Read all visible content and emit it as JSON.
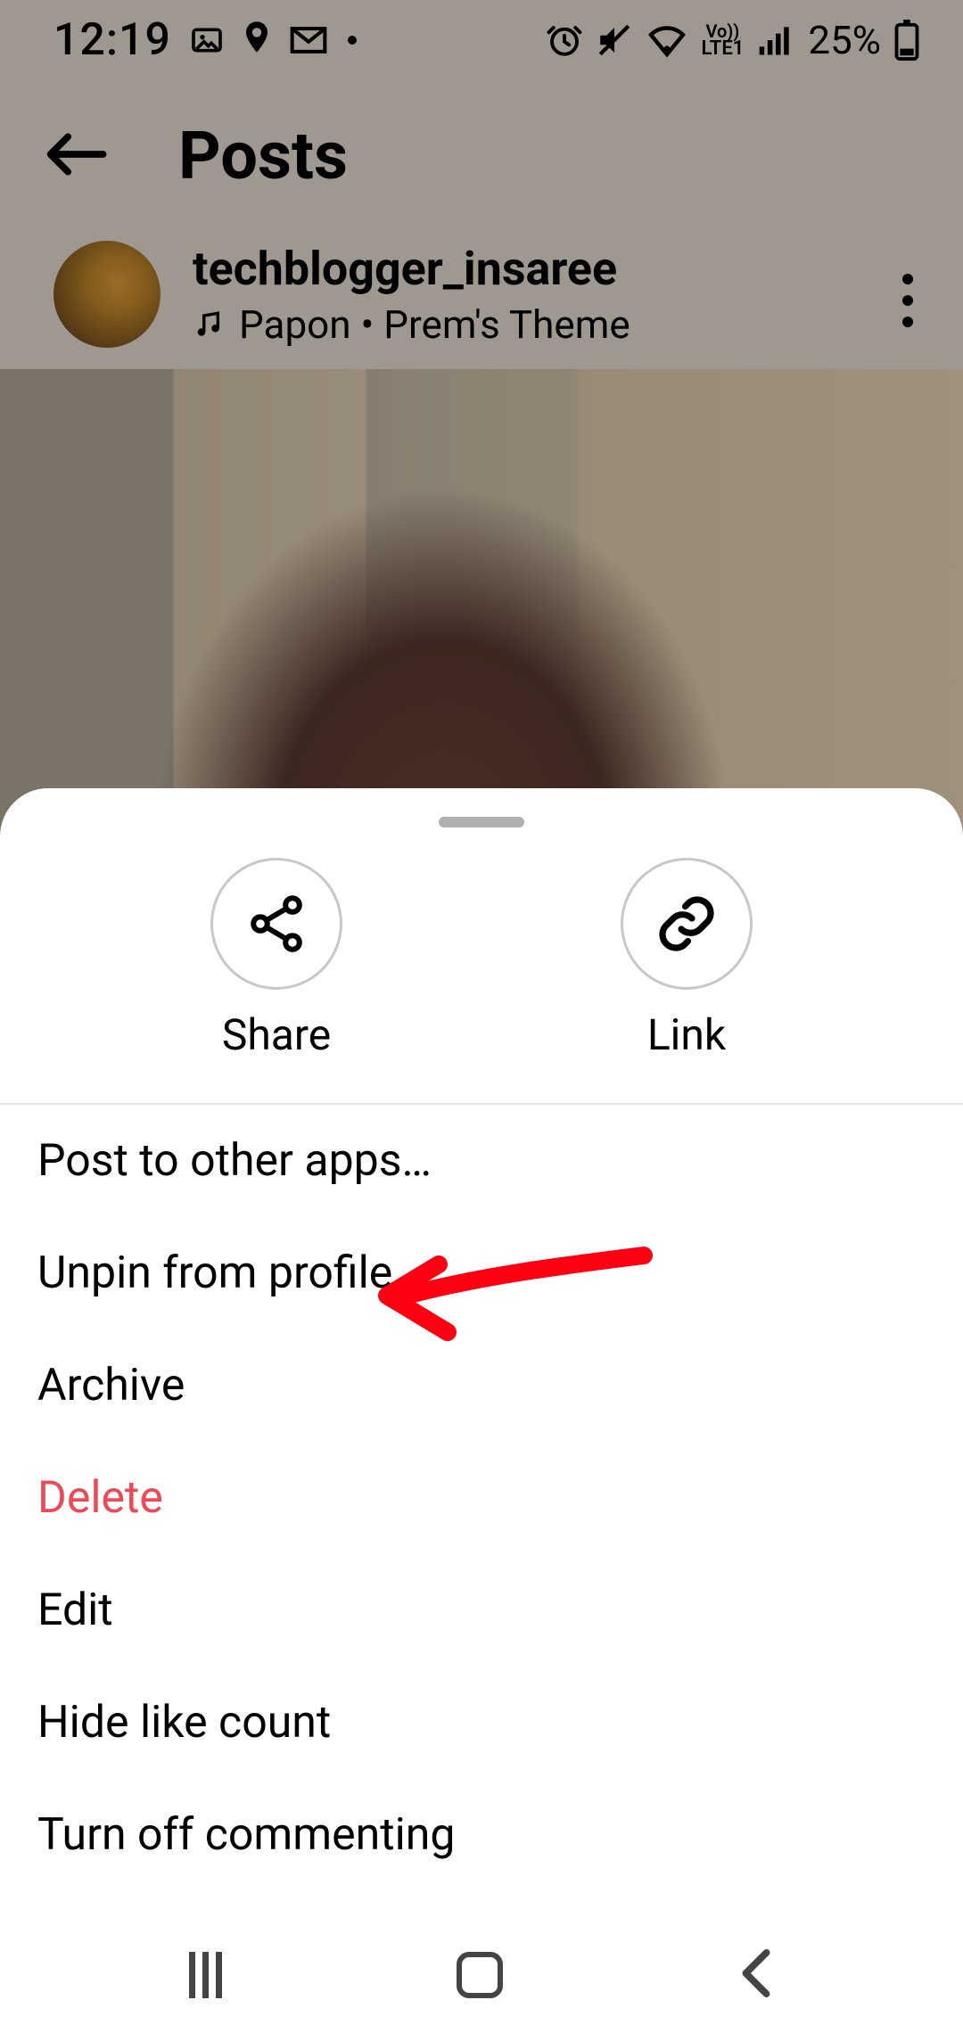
{
  "status": {
    "time": "12:19",
    "battery": "25%"
  },
  "header": {
    "title": "Posts"
  },
  "post": {
    "username": "techblogger_insaree",
    "music": "Papon • Prem's Theme"
  },
  "sheet": {
    "actions": [
      {
        "label": "Share"
      },
      {
        "label": "Link"
      }
    ],
    "menu": [
      {
        "label": "Post to other apps…",
        "danger": false
      },
      {
        "label": "Unpin from profile",
        "danger": false,
        "highlighted": true
      },
      {
        "label": "Archive",
        "danger": false
      },
      {
        "label": "Delete",
        "danger": true
      },
      {
        "label": "Edit",
        "danger": false
      },
      {
        "label": "Hide like count",
        "danger": false
      },
      {
        "label": "Turn off commenting",
        "danger": false
      }
    ]
  }
}
